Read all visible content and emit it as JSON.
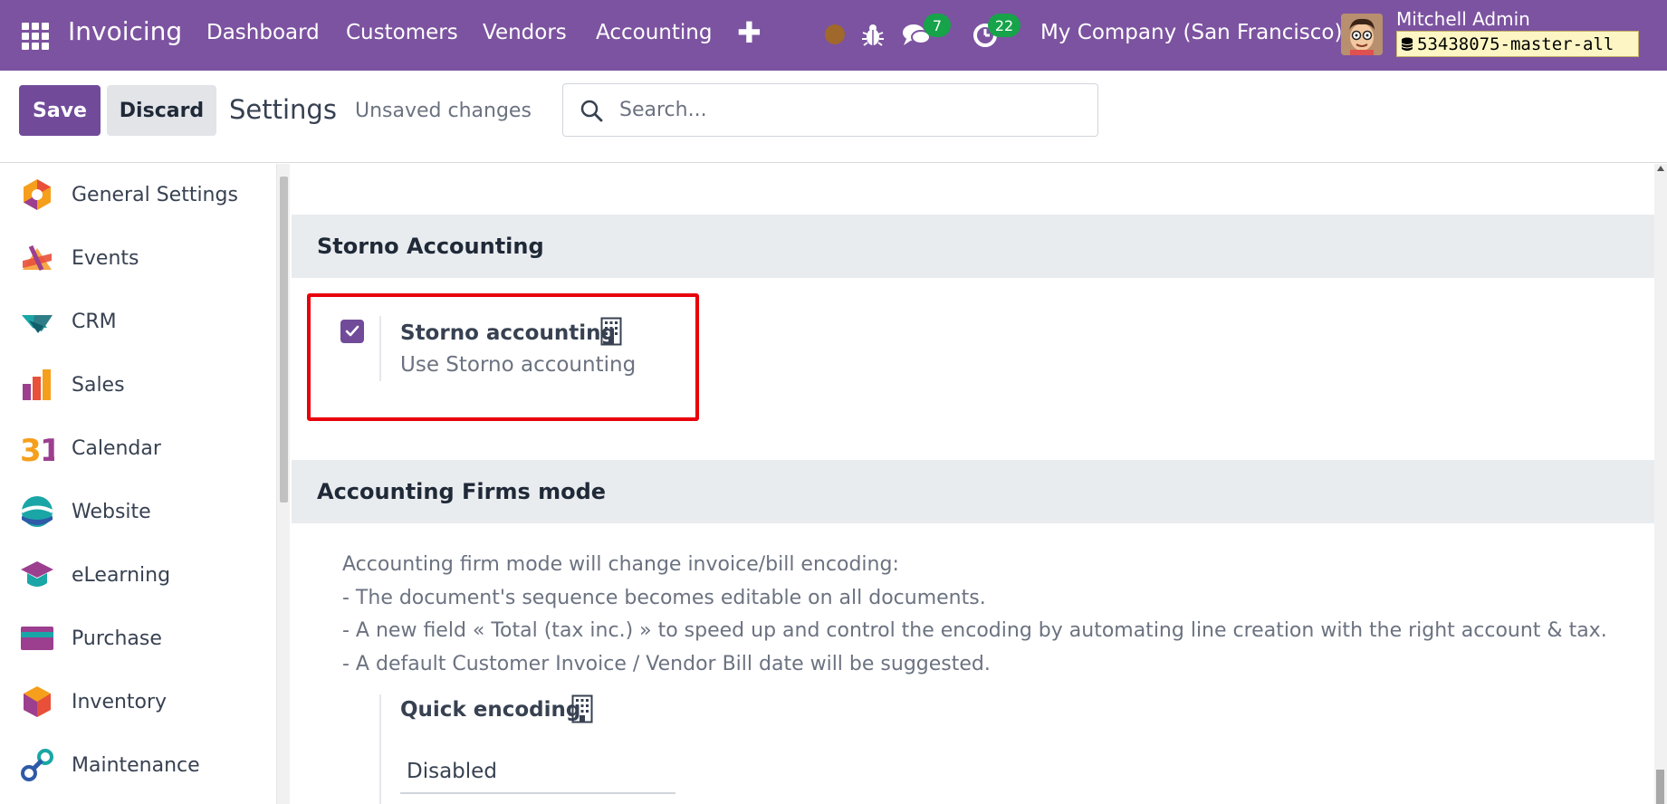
{
  "navbar": {
    "app_name": "Invoicing",
    "menu": [
      "Dashboard",
      "Customers",
      "Vendors",
      "Accounting"
    ],
    "plus_glyph": "✚",
    "chat_count": "7",
    "activity_count": "22",
    "company": "My Company (San Francisco)",
    "user_name": "Mitchell Admin",
    "database": "53438075-master-all",
    "accent_color": "#7c53a0"
  },
  "control_panel": {
    "save_label": "Save",
    "discard_label": "Discard",
    "title": "Settings",
    "status": "Unsaved changes",
    "search_placeholder": "Search..."
  },
  "sidebar": {
    "items": [
      {
        "label": "General Settings",
        "icon": "general-settings-icon"
      },
      {
        "label": "Events",
        "icon": "events-icon"
      },
      {
        "label": "CRM",
        "icon": "crm-icon"
      },
      {
        "label": "Sales",
        "icon": "sales-icon"
      },
      {
        "label": "Calendar",
        "icon": "calendar-icon"
      },
      {
        "label": "Website",
        "icon": "website-icon"
      },
      {
        "label": "eLearning",
        "icon": "elearning-icon"
      },
      {
        "label": "Purchase",
        "icon": "purchase-icon"
      },
      {
        "label": "Inventory",
        "icon": "inventory-icon"
      },
      {
        "label": "Maintenance",
        "icon": "maintenance-icon"
      }
    ]
  },
  "main": {
    "storno_section": {
      "title": "Storno Accounting",
      "setting_label": "Storno accounting",
      "setting_desc": "Use Storno accounting",
      "checked": true
    },
    "firms_section": {
      "title": "Accounting Firms mode",
      "lines": [
        "Accounting firm mode will change invoice/bill encoding:",
        "- The document's sequence becomes editable on all documents.",
        "- A new field « Total (tax inc.) » to speed up and control the encoding by automating line creation with the right account & tax.",
        "- A default Customer Invoice / Vendor Bill date will be suggested."
      ],
      "quick_encoding_label": "Quick encoding",
      "quick_encoding_value": "Disabled"
    }
  }
}
